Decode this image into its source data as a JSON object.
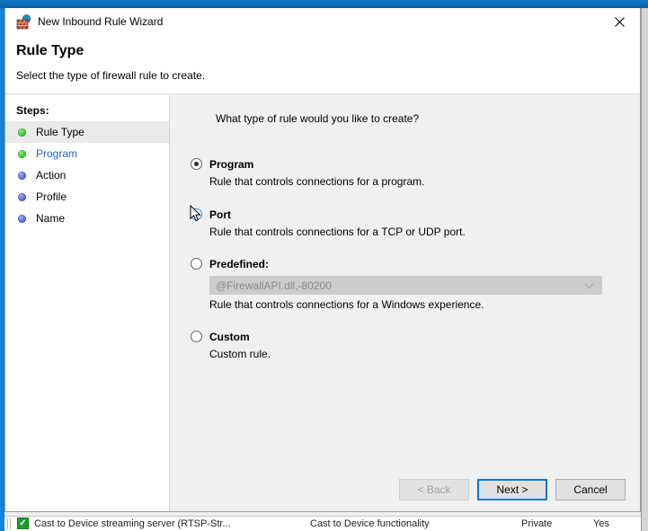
{
  "window": {
    "title": "New Inbound Rule Wizard",
    "icon": "firewall-globe-icon",
    "close_label": "✕"
  },
  "header": {
    "title": "Rule Type",
    "subtitle": "Select the type of firewall rule to create."
  },
  "steps": {
    "heading": "Steps:",
    "items": [
      {
        "label": "Rule Type",
        "state": "current",
        "bullet": "green"
      },
      {
        "label": "Program",
        "state": "link",
        "bullet": "green"
      },
      {
        "label": "Action",
        "state": "pending",
        "bullet": "blue"
      },
      {
        "label": "Profile",
        "state": "pending",
        "bullet": "blue"
      },
      {
        "label": "Name",
        "state": "pending",
        "bullet": "blue"
      }
    ]
  },
  "main": {
    "question": "What type of rule would you like to create?",
    "options": [
      {
        "label": "Program",
        "description": "Rule that controls connections for a program.",
        "selected": true
      },
      {
        "label": "Port",
        "description": "Rule that controls connections for a TCP or UDP port.",
        "selected": false,
        "hover": true
      },
      {
        "label": "Predefined:",
        "description": "Rule that controls connections for a Windows experience.",
        "selected": false,
        "combo_value": "@FirewallAPI.dll,-80200",
        "combo_disabled": true
      },
      {
        "label": "Custom",
        "description": "Custom rule.",
        "selected": false
      }
    ]
  },
  "buttons": {
    "back": "< Back",
    "next": "Next >",
    "cancel": "Cancel"
  },
  "background_window": {
    "row": {
      "name": "Cast to Device streaming server (RTSP-Str...",
      "group": "Cast to Device functionality",
      "profile": "Private",
      "enabled": "Yes",
      "checkmark": "✓"
    }
  },
  "colors": {
    "accent": "#0078d7",
    "titlebar": "#1477c4",
    "link": "#1f5fd0",
    "step_done": "#49cf43",
    "step_todo": "#6a74d8",
    "check_green": "#1d9d28"
  }
}
